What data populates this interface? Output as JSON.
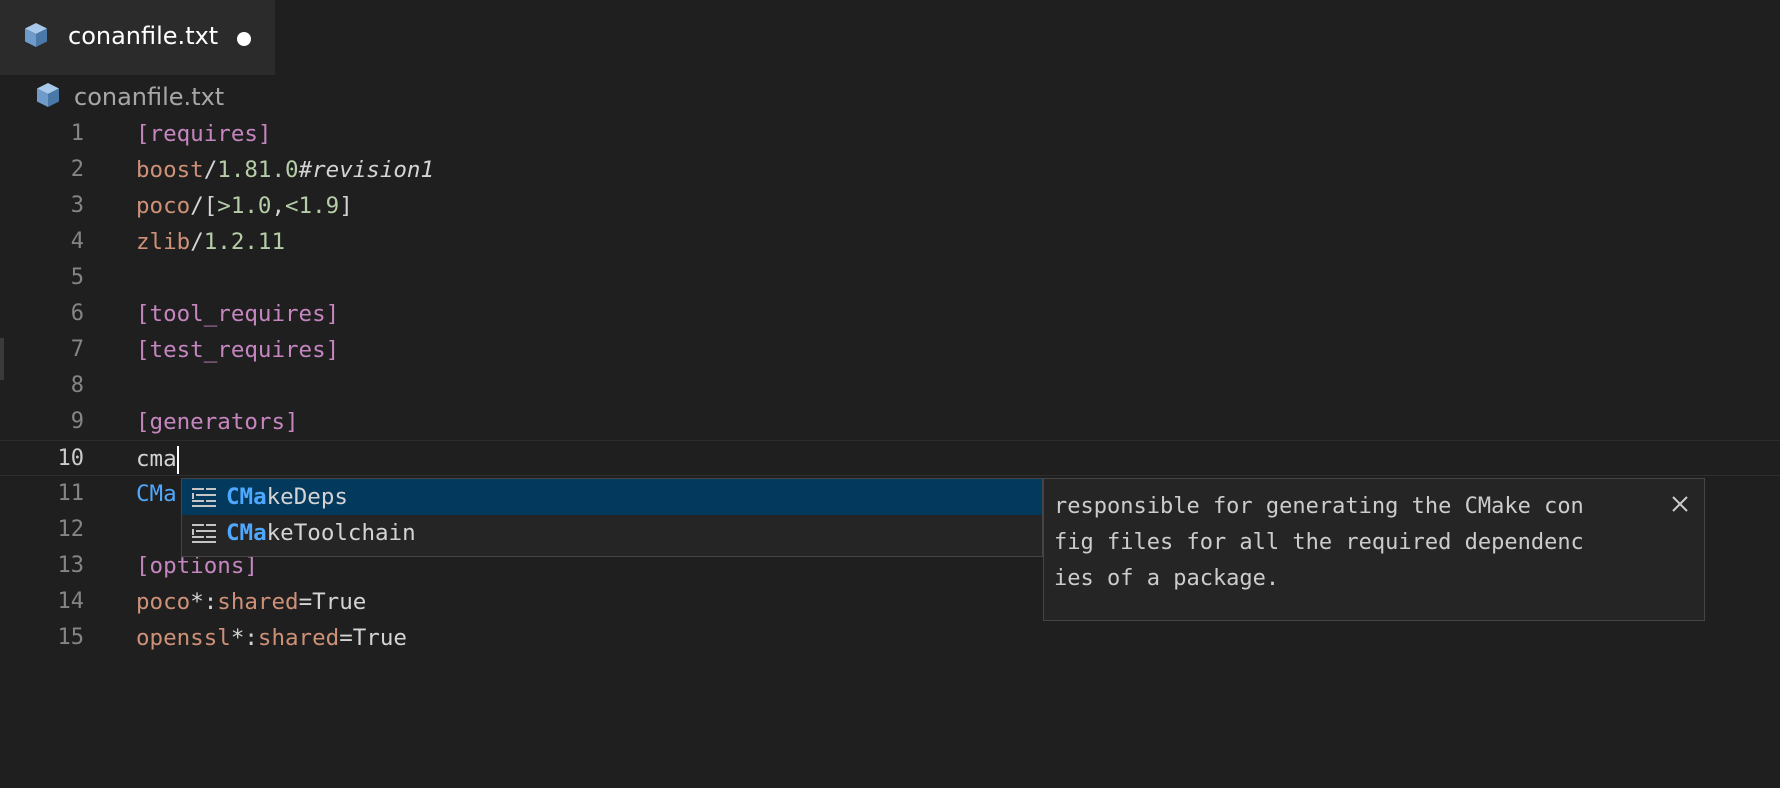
{
  "tab": {
    "label": "conanfile.txt",
    "dirty": true
  },
  "breadcrumb": {
    "label": "conanfile.txt"
  },
  "editor": {
    "current_line": 10,
    "line_numbers": [
      "1",
      "2",
      "3",
      "4",
      "5",
      "6",
      "7",
      "8",
      "9",
      "10",
      "11",
      "12",
      "13",
      "14",
      "15"
    ],
    "lines": {
      "l1": {
        "sec": "[requires]"
      },
      "l2": {
        "pkg": "boost",
        "slash": "/",
        "ver": "1.81.0",
        "rev": "#revision1"
      },
      "l3": {
        "pkg": "poco",
        "rest_a": "/[",
        "ver_a": ">1.0",
        "comma": ",",
        "ver_b": "<1.9",
        "close": "]"
      },
      "l4": {
        "pkg": "zlib",
        "slash": "/",
        "ver": "1.2.11"
      },
      "l6": {
        "sec": "[tool_requires]"
      },
      "l7": {
        "sec": "[test_requires]"
      },
      "l9": {
        "sec": "[generators]"
      },
      "l10": {
        "text": "cma"
      },
      "l11": {
        "text": "CMa"
      },
      "l13": {
        "sec": "[options]"
      },
      "l14": {
        "pkg": "poco",
        "star": "*:",
        "key": "shared",
        "eq": "=",
        "val": "True"
      },
      "l15": {
        "pkg": "openssl",
        "star": "*:",
        "key": "shared",
        "eq": "=",
        "val": "True"
      }
    }
  },
  "suggestions": [
    {
      "match": "CMa",
      "rest": "keDeps",
      "icon": "text-lines-icon",
      "selected": true
    },
    {
      "match": "CMa",
      "rest": "keToolchain",
      "icon": "text-lines-icon",
      "selected": false
    }
  ],
  "details": {
    "lines": [
      "responsible for generating the CMake con",
      "fig files for all the required dependenc",
      "ies of a package."
    ],
    "close_icon": "close-icon"
  },
  "colors": {
    "background": "#1f1f1f",
    "section": "#c586c0",
    "package": "#ce9178",
    "version": "#b5cea8",
    "match_highlight": "#4fa8ff",
    "selected_suggestion": "#04395e"
  }
}
